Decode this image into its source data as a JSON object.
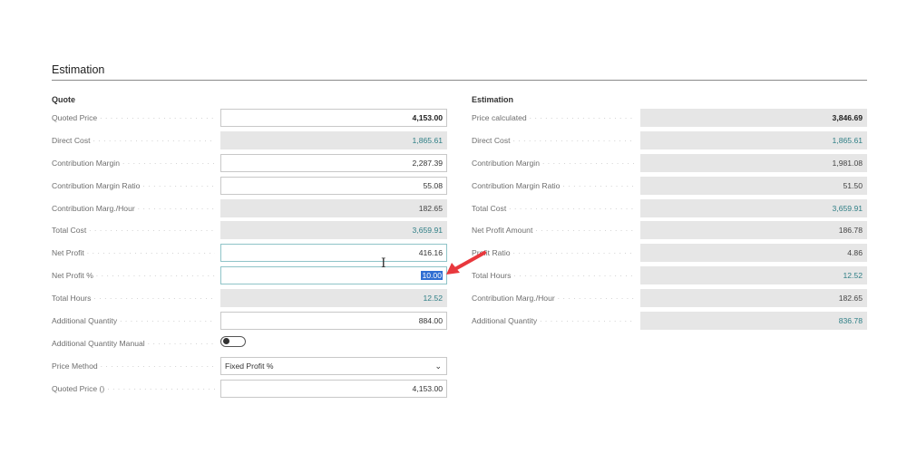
{
  "section": {
    "title": "Estimation"
  },
  "quote": {
    "title": "Quote",
    "rows": [
      {
        "label": "Quoted Price",
        "value": "4,153.00",
        "kind": "input-bold"
      },
      {
        "label": "Direct Cost",
        "value": "1,865.61",
        "kind": "readonly-link"
      },
      {
        "label": "Contribution Margin",
        "value": "2,287.39",
        "kind": "input"
      },
      {
        "label": "Contribution Margin Ratio",
        "value": "55.08",
        "kind": "input"
      },
      {
        "label": "Contribution Marg./Hour",
        "value": "182.65",
        "kind": "readonly"
      },
      {
        "label": "Total Cost",
        "value": "3,659.91",
        "kind": "readonly-link"
      },
      {
        "label": "Net Profit",
        "value": "416.16",
        "kind": "input-focus"
      },
      {
        "label": "Net Profit %",
        "value": "10.00",
        "kind": "input-selected"
      },
      {
        "label": "Total Hours",
        "value": "12.52",
        "kind": "readonly-link"
      },
      {
        "label": "Additional Quantity",
        "value": "884.00",
        "kind": "input"
      }
    ],
    "toggle": {
      "label": "Additional Quantity Manual",
      "on": false
    },
    "select": {
      "label": "Price Method",
      "value": "Fixed Profit %"
    },
    "last": {
      "label": "Quoted Price ()",
      "value": "4,153.00"
    }
  },
  "estimation": {
    "title": "Estimation",
    "rows": [
      {
        "label": "Price calculated",
        "value": "3,846.69",
        "kind": "readonly-bold"
      },
      {
        "label": "Direct Cost",
        "value": "1,865.61",
        "kind": "readonly-link"
      },
      {
        "label": "Contribution Margin",
        "value": "1,981.08",
        "kind": "readonly"
      },
      {
        "label": "Contribution Margin Ratio",
        "value": "51.50",
        "kind": "readonly"
      },
      {
        "label": "Total Cost",
        "value": "3,659.91",
        "kind": "readonly-link"
      },
      {
        "label": "Net Profit Amount",
        "value": "186.78",
        "kind": "readonly"
      },
      {
        "label": "Profit Ratio",
        "value": "4.86",
        "kind": "readonly"
      },
      {
        "label": "Total Hours",
        "value": "12.52",
        "kind": "readonly-link"
      },
      {
        "label": "Contribution Marg./Hour",
        "value": "182.65",
        "kind": "readonly"
      },
      {
        "label": "Additional Quantity",
        "value": "836.78",
        "kind": "readonly-link"
      }
    ]
  },
  "annotations": {
    "arrow_color": "#e8383d"
  }
}
